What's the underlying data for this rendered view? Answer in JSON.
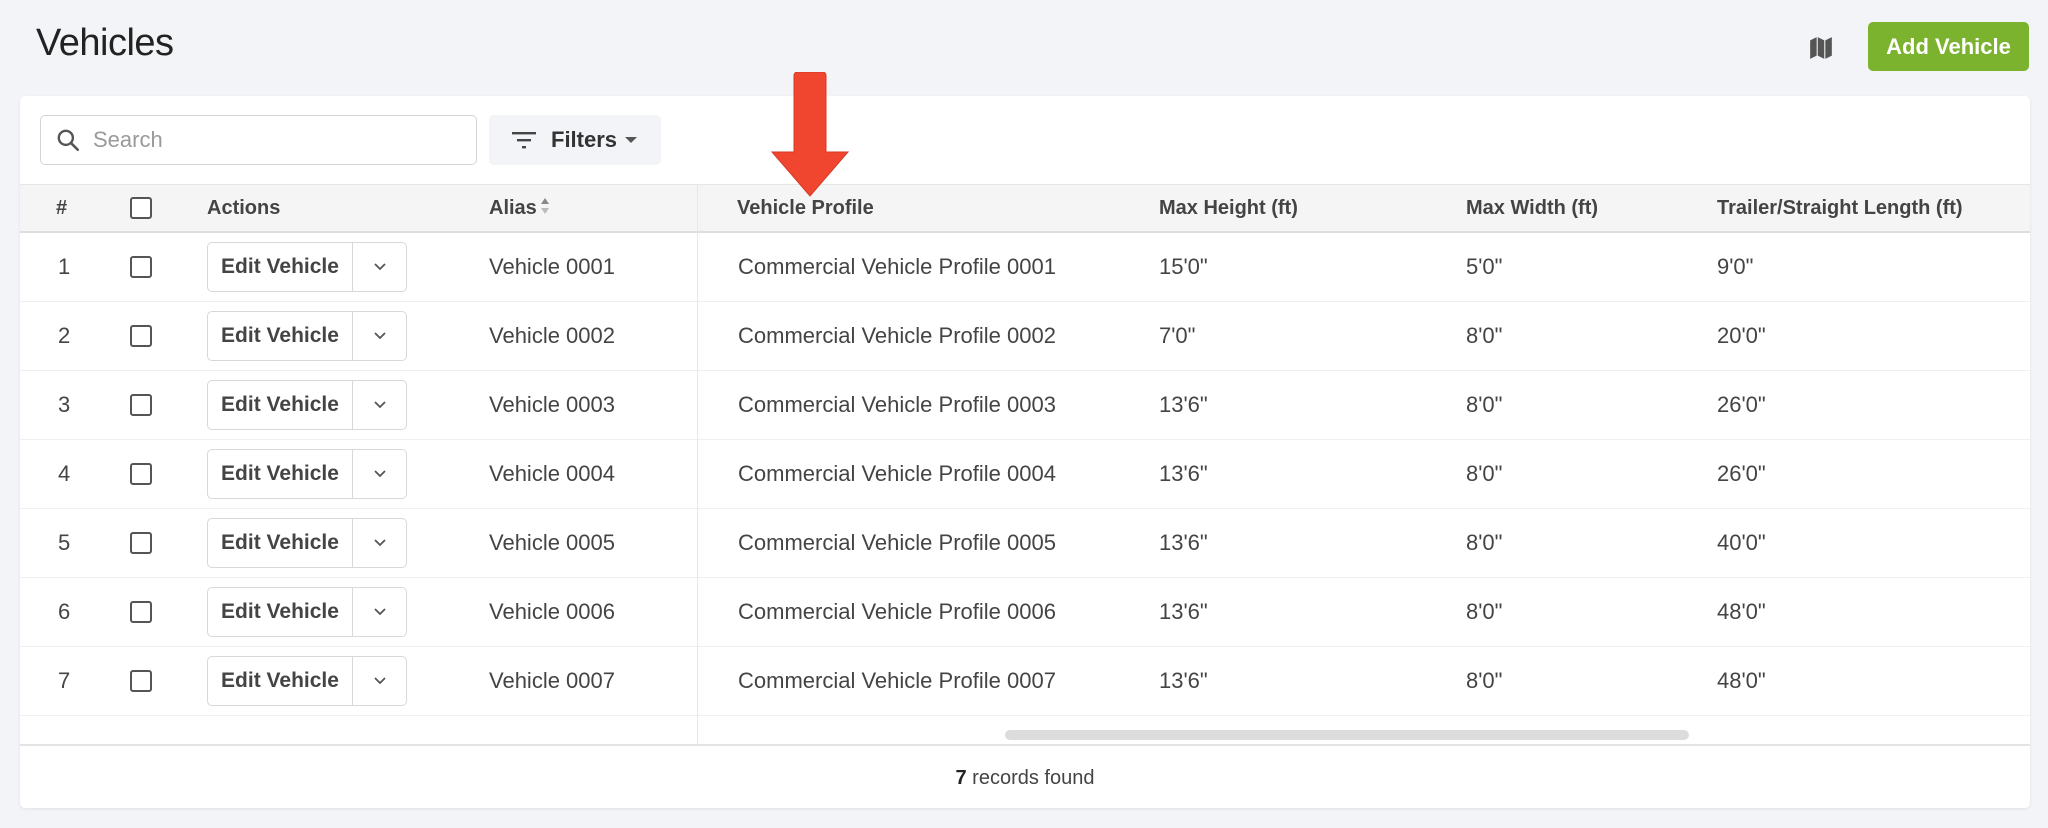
{
  "header": {
    "title": "Vehicles",
    "map_icon": "map-icon",
    "add_button_label": "Add Vehicle",
    "accent_color": "#7cb32e"
  },
  "toolbar": {
    "search_placeholder": "Search",
    "search_value": "",
    "filters_label": "Filters"
  },
  "table": {
    "columns": {
      "index": "#",
      "actions": "Actions",
      "alias": "Alias",
      "profile": "Vehicle Profile",
      "max_height": "Max Height (ft)",
      "max_width": "Max Width (ft)",
      "length": "Trailer/Straight Length (ft)"
    },
    "action_button_label": "Edit Vehicle",
    "rows": [
      {
        "index": "1",
        "alias": "Vehicle 0001",
        "profile": "Commercial Vehicle Profile 0001",
        "max_height": "15'0\"",
        "max_width": "5'0\"",
        "length": "9'0\""
      },
      {
        "index": "2",
        "alias": "Vehicle 0002",
        "profile": "Commercial Vehicle Profile 0002",
        "max_height": "7'0\"",
        "max_width": "8'0\"",
        "length": "20'0\""
      },
      {
        "index": "3",
        "alias": "Vehicle 0003",
        "profile": "Commercial Vehicle Profile 0003",
        "max_height": "13'6\"",
        "max_width": "8'0\"",
        "length": "26'0\""
      },
      {
        "index": "4",
        "alias": "Vehicle 0004",
        "profile": "Commercial Vehicle Profile 0004",
        "max_height": "13'6\"",
        "max_width": "8'0\"",
        "length": "26'0\""
      },
      {
        "index": "5",
        "alias": "Vehicle 0005",
        "profile": "Commercial Vehicle Profile 0005",
        "max_height": "13'6\"",
        "max_width": "8'0\"",
        "length": "40'0\""
      },
      {
        "index": "6",
        "alias": "Vehicle 0006",
        "profile": "Commercial Vehicle Profile 0006",
        "max_height": "13'6\"",
        "max_width": "8'0\"",
        "length": "48'0\""
      },
      {
        "index": "7",
        "alias": "Vehicle 0007",
        "profile": "Commercial Vehicle Profile 0007",
        "max_height": "13'6\"",
        "max_width": "8'0\"",
        "length": "48'0\""
      }
    ]
  },
  "footer": {
    "count": "7",
    "label": " records found"
  },
  "annotation": {
    "type": "arrow-down",
    "color": "#f04630",
    "points_to": "Vehicle Profile"
  }
}
